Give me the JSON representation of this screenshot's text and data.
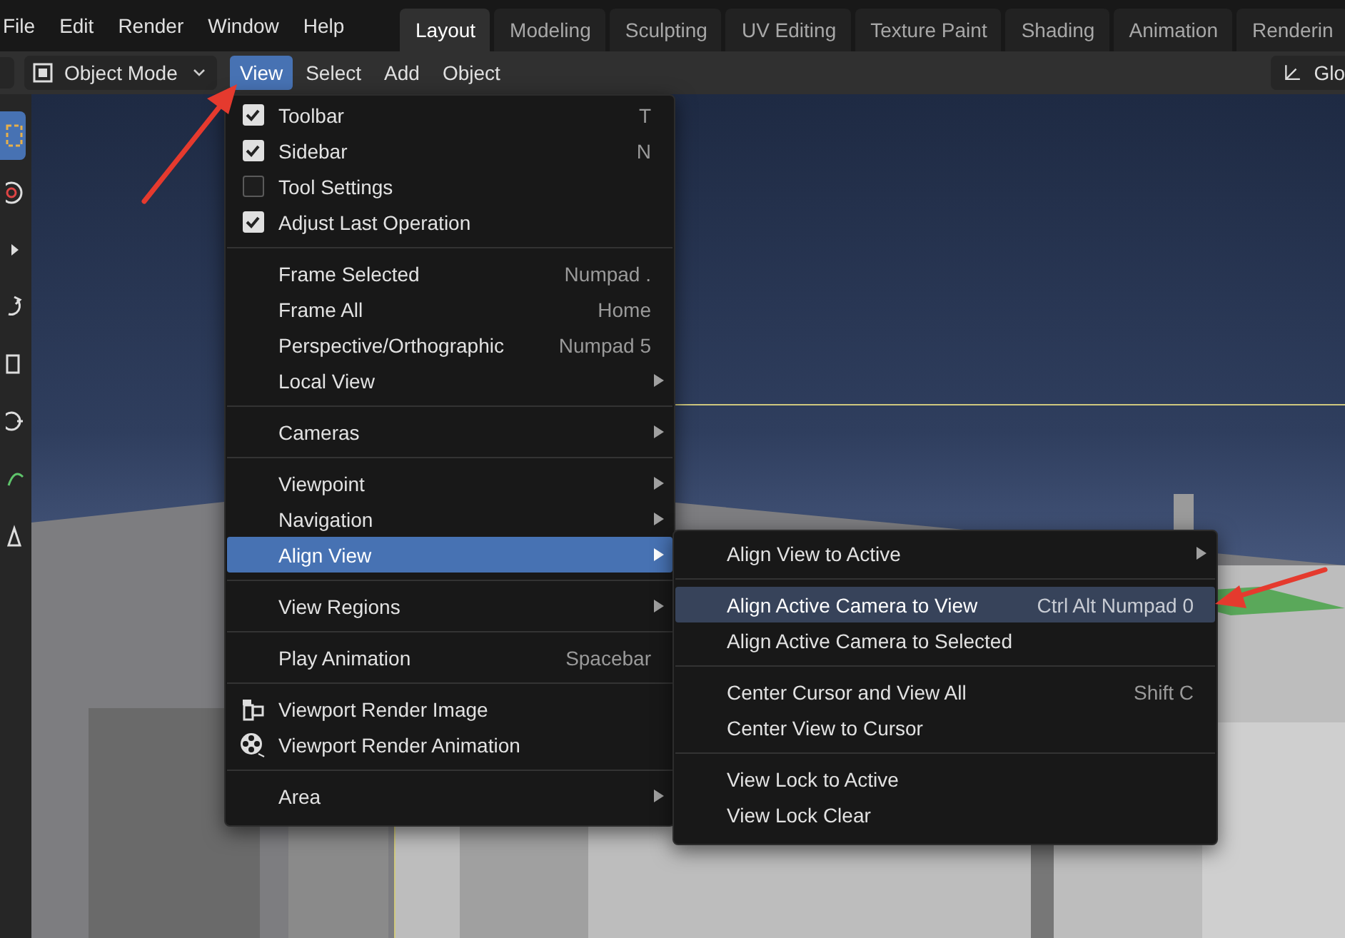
{
  "top_menu": [
    {
      "label": "File"
    },
    {
      "label": "Edit"
    },
    {
      "label": "Render"
    },
    {
      "label": "Window"
    },
    {
      "label": "Help"
    }
  ],
  "workspace_tabs": [
    {
      "label": "Layout",
      "selected": true
    },
    {
      "label": "Modeling",
      "selected": false
    },
    {
      "label": "Sculpting",
      "selected": false
    },
    {
      "label": "UV Editing",
      "selected": false
    },
    {
      "label": "Texture Paint",
      "selected": false
    },
    {
      "label": "Shading",
      "selected": false
    },
    {
      "label": "Animation",
      "selected": false
    },
    {
      "label": "Renderin",
      "selected": false
    }
  ],
  "header": {
    "mode": "Object Mode",
    "menus": [
      {
        "label": "View",
        "selected": true
      },
      {
        "label": "Select",
        "selected": false
      },
      {
        "label": "Add",
        "selected": false
      },
      {
        "label": "Object",
        "selected": false
      }
    ],
    "orientation": "Glo"
  },
  "toolbar": [
    {
      "kind": "select",
      "selected": true
    },
    {
      "kind": "cursor",
      "selected": false
    },
    {
      "kind": "move",
      "selected": false
    },
    {
      "kind": "rotate",
      "selected": false
    },
    {
      "kind": "scale",
      "selected": false
    },
    {
      "kind": "transform",
      "selected": false
    },
    {
      "kind": "annotate",
      "selected": false
    },
    {
      "kind": "measure",
      "selected": false
    }
  ],
  "view_menu": {
    "groups": [
      {
        "items": [
          {
            "kind": "check",
            "label": "Toolbar",
            "shortcut": "T",
            "checked": true,
            "selected": false
          },
          {
            "kind": "check",
            "label": "Sidebar",
            "shortcut": "N",
            "checked": true,
            "selected": false
          },
          {
            "kind": "check",
            "label": "Tool Settings",
            "checked": false,
            "selected": false
          },
          {
            "kind": "check",
            "label": "Adjust Last Operation",
            "checked": true,
            "selected": false
          }
        ]
      },
      {
        "items": [
          {
            "kind": "plain",
            "label": "Frame Selected",
            "shortcut": "Numpad .",
            "selected": false
          },
          {
            "kind": "plain",
            "label": "Frame All",
            "shortcut": "Home",
            "selected": false
          },
          {
            "kind": "plain",
            "label": "Perspective/Orthographic",
            "shortcut": "Numpad 5",
            "selected": false
          },
          {
            "kind": "submenu",
            "label": "Local View",
            "selected": false
          }
        ]
      },
      {
        "items": [
          {
            "kind": "submenu",
            "label": "Cameras",
            "selected": false
          }
        ]
      },
      {
        "items": [
          {
            "kind": "submenu",
            "label": "Viewpoint",
            "selected": false
          },
          {
            "kind": "submenu",
            "label": "Navigation",
            "selected": false
          },
          {
            "kind": "submenu",
            "label": "Align View",
            "selected": true
          }
        ]
      },
      {
        "items": [
          {
            "kind": "submenu",
            "label": "View Regions",
            "selected": false
          }
        ]
      },
      {
        "items": [
          {
            "kind": "plain",
            "label": "Play Animation",
            "shortcut": "Spacebar",
            "selected": false
          }
        ]
      },
      {
        "items": [
          {
            "kind": "render-image",
            "label": "Viewport Render Image",
            "selected": false
          },
          {
            "kind": "render-animation",
            "label": "Viewport Render Animation",
            "selected": false
          }
        ]
      },
      {
        "items": [
          {
            "kind": "submenu",
            "label": "Area",
            "selected": false
          }
        ]
      }
    ]
  },
  "align_view_submenu": {
    "groups": [
      {
        "items": [
          {
            "kind": "submenu",
            "label": "Align View to Active",
            "selected": false
          }
        ]
      },
      {
        "items": [
          {
            "kind": "plain",
            "label": "Align Active Camera to View",
            "shortcut": "Ctrl Alt Numpad 0",
            "selected": true
          },
          {
            "kind": "plain",
            "label": "Align Active Camera to Selected",
            "selected": false
          }
        ]
      },
      {
        "items": [
          {
            "kind": "plain",
            "label": "Center Cursor and View All",
            "shortcut": "Shift C",
            "selected": false
          },
          {
            "kind": "plain",
            "label": "Center View to Cursor",
            "selected": false
          }
        ]
      },
      {
        "items": [
          {
            "kind": "plain",
            "label": "View Lock to Active",
            "selected": false
          },
          {
            "kind": "plain",
            "label": "View Lock Clear",
            "selected": false
          }
        ]
      }
    ]
  }
}
